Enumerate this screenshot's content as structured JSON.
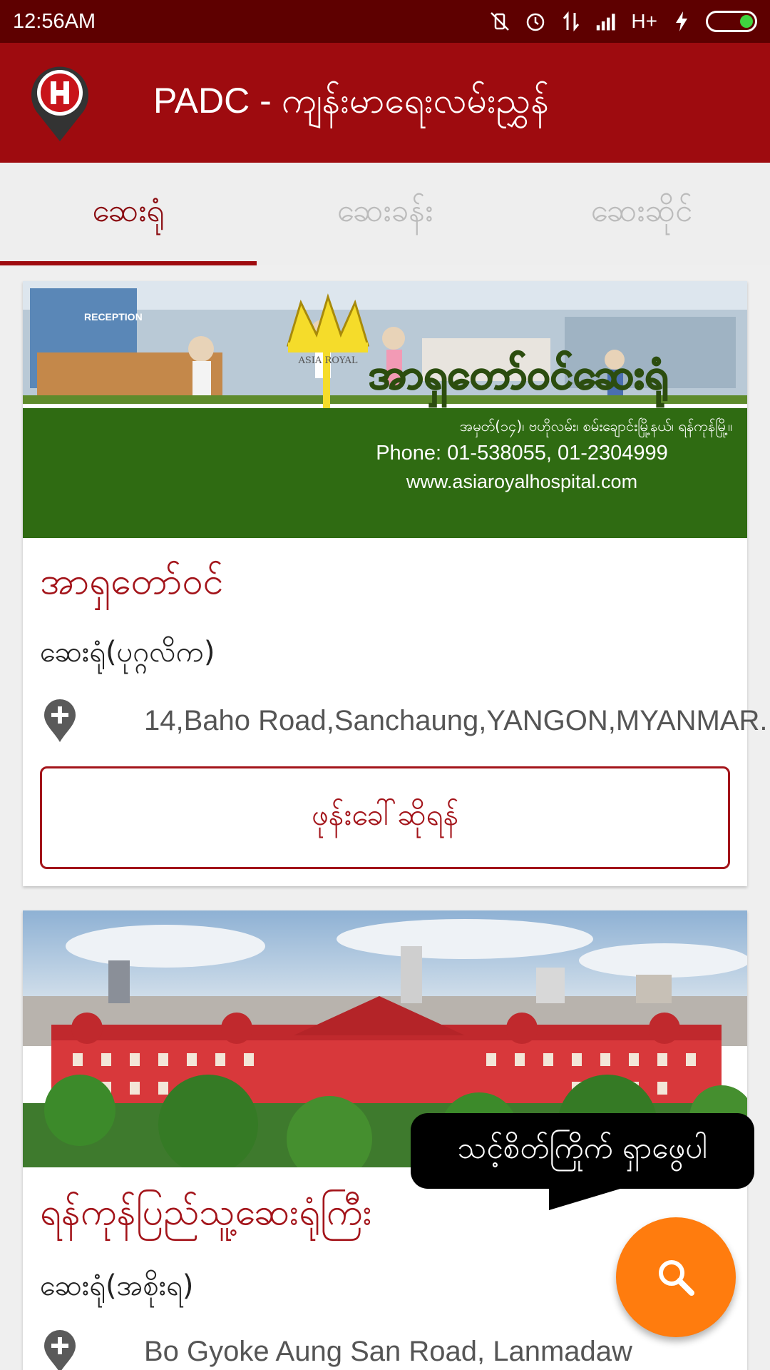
{
  "status_bar": {
    "time": "12:56AM",
    "network": "H+"
  },
  "app_bar": {
    "title": "PADC - ကျန်းမာရေးလမ်းညွှန်"
  },
  "tabs": [
    {
      "label": "ဆေးရုံ",
      "active": true
    },
    {
      "label": "ဆေးခန်း",
      "active": false
    },
    {
      "label": "ဆေးဆိုင်",
      "active": false
    }
  ],
  "cards": [
    {
      "banner": {
        "name": "အာရှတော်ဝင်ဆေးရုံ",
        "reception": "RECEPTION",
        "crown_label": "ASIA ROYAL",
        "address": "အမှတ်(၁၄)၊ ဗဟိုလမ်း၊ စမ်းချောင်းမြို့နယ်၊ ရန်ကုန်မြို့။",
        "phone": "Phone: 01-538055, 01-2304999",
        "website": "www.asiaroyalhospital.com"
      },
      "title": "အာရှတော်ဝင်",
      "type": "ဆေးရုံ(ပုဂ္ဂလိက)",
      "address": "14,Baho Road,Sanchaung,YANGON,MYANMAR.",
      "call_label": "ဖုန်းခေါ်ဆိုရန်"
    },
    {
      "title": "ရန်ကုန်ပြည်သူ့ဆေးရုံကြီး",
      "type": "ဆေးရုံ(အစိုးရ)",
      "address": "Bo Gyoke Aung San Road, Lanmadaw"
    }
  ],
  "search_tooltip": "သင့်စိတ်ကြိုက် ရှာဖွေပါ",
  "colors": {
    "primary": "#9e0b0f",
    "status_bar": "#5e0000",
    "fab": "#ff7c0e",
    "title_text": "#a3141a"
  },
  "icons": [
    "hospital-logo-icon",
    "map-pin-plus-icon",
    "search-icon"
  ]
}
